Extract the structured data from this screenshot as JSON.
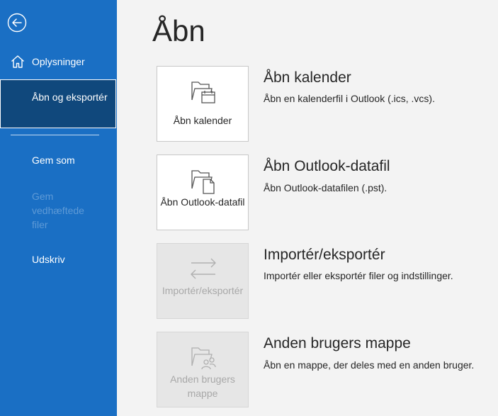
{
  "colors": {
    "sidebar_bg": "#1a6fc4",
    "sidebar_selected_bg": "#10487c",
    "content_bg": "#f3f3f3",
    "disabled_text": "#a8a8a8"
  },
  "sidebar": {
    "back_icon": "back-arrow-icon",
    "items": [
      {
        "label": "Oplysninger",
        "icon": "home-icon",
        "state": "normal"
      },
      {
        "label": "Åbn og eksportér",
        "state": "selected"
      },
      {
        "label": "Gem som",
        "state": "normal"
      },
      {
        "label": "Gem vedhæftede filer",
        "state": "disabled"
      },
      {
        "label": "Udskriv",
        "state": "normal"
      }
    ]
  },
  "main": {
    "title": "Åbn",
    "options": [
      {
        "tile_label": "Åbn kalender",
        "title": "Åbn kalender",
        "description": "Åbn en kalenderfil i Outlook (.ics, .vcs).",
        "icon": "folder-calendar-icon",
        "enabled": true
      },
      {
        "tile_label": "Åbn Outlook-datafil",
        "title": "Åbn Outlook-datafil",
        "description": "Åbn Outlook-datafilen (.pst).",
        "icon": "folder-document-icon",
        "enabled": true
      },
      {
        "tile_label": "Importér/eksportér",
        "title": "Importér/eksportér",
        "description": "Importér eller eksportér filer og indstillinger.",
        "icon": "import-export-arrows-icon",
        "enabled": false
      },
      {
        "tile_label": "Anden brugers mappe",
        "title": "Anden brugers mappe",
        "description": "Åbn en mappe, der deles med en anden bruger.",
        "icon": "folder-users-icon",
        "enabled": false
      }
    ]
  }
}
